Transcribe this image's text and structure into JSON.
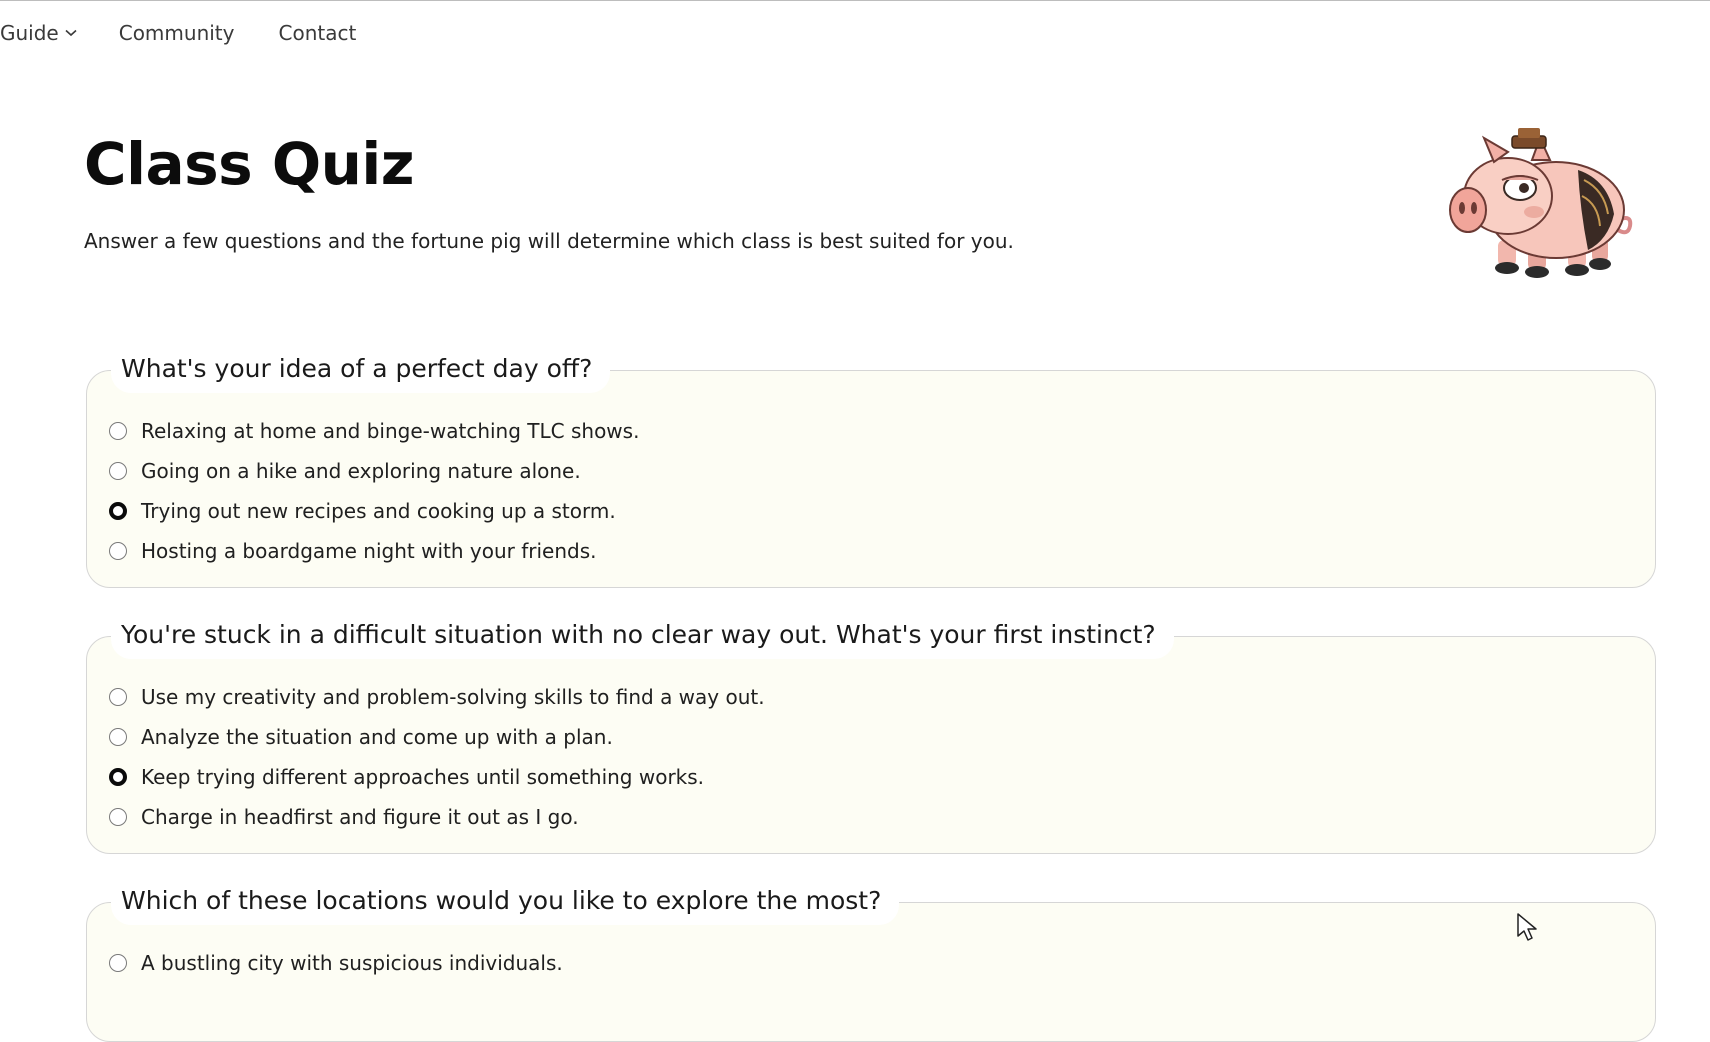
{
  "nav": {
    "items": [
      {
        "label": "Guide",
        "has_dropdown": true
      },
      {
        "label": "Community",
        "has_dropdown": false
      },
      {
        "label": "Contact",
        "has_dropdown": false
      }
    ]
  },
  "header": {
    "title": "Class Quiz",
    "subtitle": "Answer a few questions and the fortune pig will determine which class is best suited for you.",
    "mascot_icon": "fortune-pig-icon"
  },
  "questions": [
    {
      "prompt": "What's your idea of a perfect day off?",
      "options": [
        {
          "label": "Relaxing at home and binge-watching TLC shows.",
          "selected": false
        },
        {
          "label": "Going on a hike and exploring nature alone.",
          "selected": false
        },
        {
          "label": "Trying out new recipes and cooking up a storm.",
          "selected": true
        },
        {
          "label": "Hosting a boardgame night with your friends.",
          "selected": false
        }
      ]
    },
    {
      "prompt": "You're stuck in a difficult situation with no clear way out. What's your first instinct?",
      "options": [
        {
          "label": "Use my creativity and problem-solving skills to find a way out.",
          "selected": false
        },
        {
          "label": "Analyze the situation and come up with a plan.",
          "selected": false
        },
        {
          "label": "Keep trying different approaches until something works.",
          "selected": true
        },
        {
          "label": "Charge in headfirst and figure it out as I go.",
          "selected": false
        }
      ]
    },
    {
      "prompt": "Which of these locations would you like to explore the most?",
      "options": [
        {
          "label": "A bustling city with suspicious individuals.",
          "selected": false
        }
      ]
    }
  ],
  "colors": {
    "panel_bg": "#fdfdf4",
    "panel_border": "#d6d6d6",
    "title": "#0c0c0c"
  }
}
